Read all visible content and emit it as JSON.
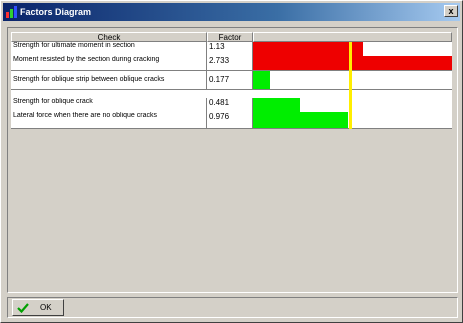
{
  "window": {
    "title": "Factors Diagram",
    "close_label": "x"
  },
  "table": {
    "headers": {
      "check": "Check",
      "factor": "Factor"
    },
    "limit_factor": 1.0,
    "bar_max_factor": 2.05,
    "rows": [
      {
        "check": "Strength for ultimate moment in section",
        "factor": "1.13",
        "value": 1.13,
        "status": "fail"
      },
      {
        "check": "Moment resisted by the section during cracking",
        "factor": "2.733",
        "value": 2.733,
        "status": "fail"
      },
      {
        "check": "Strength for oblique strip between oblique cracks",
        "factor": "0.177",
        "value": 0.177,
        "status": "ok"
      },
      {
        "check": "Strength for oblique crack",
        "factor": "0.481",
        "value": 0.481,
        "status": "ok"
      },
      {
        "check": "Lateral force when there are no oblique cracks",
        "factor": "0.976",
        "value": 0.976,
        "status": "ok"
      }
    ]
  },
  "colors": {
    "fail": "#ee0000",
    "ok": "#00ee00",
    "limit": "#ffee00"
  },
  "footer": {
    "ok_label": "OK"
  }
}
